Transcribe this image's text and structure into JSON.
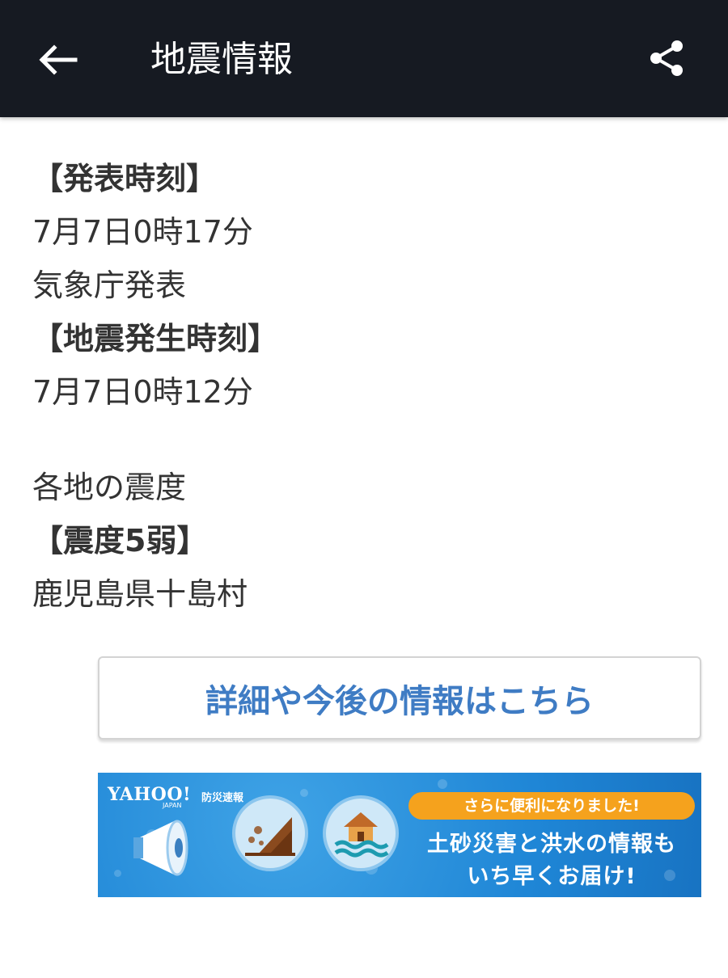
{
  "header": {
    "title": "地震情報"
  },
  "content": {
    "announce_heading": "【発表時刻】",
    "announce_time": "7月7日0時17分",
    "announcer": "気象庁発表",
    "quake_heading": "【地震発生時刻】",
    "quake_time": "7月7日0時12分",
    "intensity_label": "各地の震度",
    "intensity_heading": "【震度5弱】",
    "intensity_area": "鹿児島県十島村"
  },
  "detail_button": {
    "label": "詳細や今後の情報はこちら"
  },
  "banner": {
    "logo": "YAHOO!",
    "logo_sub": "防災速報",
    "logo_japan": "JAPAN",
    "pill_text": "さらに便利になりました!",
    "line1": "土砂災害と洪水の情報も",
    "line2": "いち早くお届け!"
  },
  "colors": {
    "appbar": "#161a22",
    "link": "#3f7cc4",
    "banner": "#1f86d6",
    "pill": "#f5a21d"
  }
}
